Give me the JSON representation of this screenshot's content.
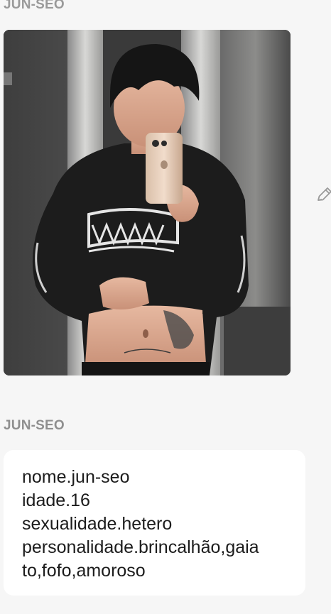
{
  "top_message": {
    "sender": "JUN-SEO",
    "image_description_icon": "selfie-photo"
  },
  "edit_icon": "pencil-icon",
  "text_message": {
    "sender": "JUN-SEO",
    "lines": [
      "nome.jun-seo",
      "idade.16",
      "sexualidade.hetero",
      "personalidade.brincalhão,gaia",
      "to,fofo,amoroso"
    ]
  },
  "colors": {
    "background": "#f6f6f6",
    "bubble": "#ffffff",
    "sender_label": "#9a9a9a",
    "text": "#1c1c1c"
  }
}
